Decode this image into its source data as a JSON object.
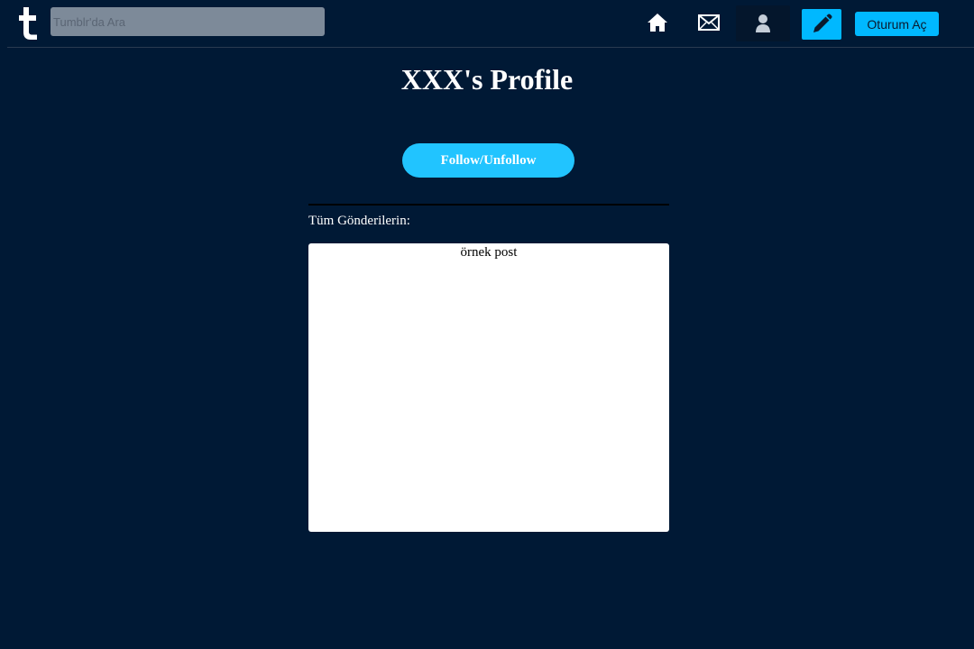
{
  "header": {
    "logo_icon": "tumblr-logo-icon",
    "search_placeholder": "Tumblr'da Ara",
    "nav_icons": [
      "home-icon",
      "mail-icon",
      "user-icon",
      "edit-icon"
    ],
    "login_label": "Oturum Aç"
  },
  "profile": {
    "title": "XXX's Profile",
    "follow_label": "Follow/Unfollow",
    "posts_label": "Tüm Gönderilerin:"
  },
  "posts": [
    {
      "text": "örnek post"
    }
  ],
  "colors": {
    "background": "#001935",
    "accent": "#00b8ff",
    "follow_button": "#21c4ff",
    "card": "#ffffff"
  }
}
